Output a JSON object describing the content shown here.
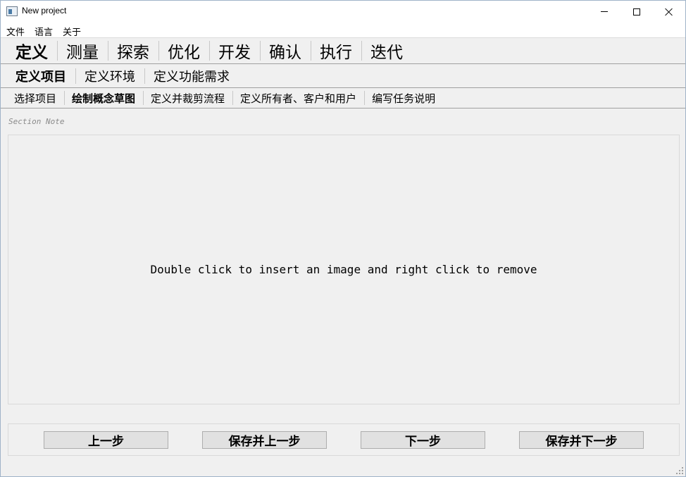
{
  "window": {
    "title": "New project"
  },
  "menubar": {
    "items": [
      "文件",
      "语言",
      "关于"
    ]
  },
  "primary_tabs": {
    "items": [
      "定义",
      "测量",
      "探索",
      "优化",
      "开发",
      "确认",
      "执行",
      "迭代"
    ],
    "active": "定义"
  },
  "secondary_tabs": {
    "items": [
      "定义项目",
      "定义环境",
      "定义功能需求"
    ],
    "active": "定义项目"
  },
  "tertiary_tabs": {
    "items": [
      "选择项目",
      "绘制概念草图",
      "定义并裁剪流程",
      "定义所有者、客户和用户",
      "编写任务说明"
    ],
    "active": "绘制概念草图"
  },
  "section": {
    "note": "Section Note",
    "image_hint": "Double click to insert an image and right click to remove"
  },
  "navigation": {
    "prev": "上一步",
    "save_prev": "保存并上一步",
    "next": "下一步",
    "save_next": "保存并下一步"
  }
}
